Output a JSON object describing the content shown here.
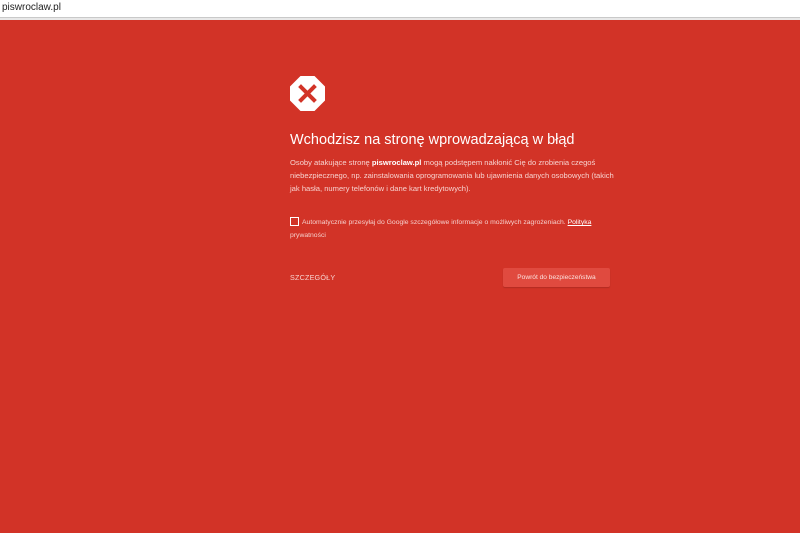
{
  "browser": {
    "url": "piswroclaw.pl"
  },
  "page": {
    "heading": "Wchodzisz na stronę wprowadzającą w błąd",
    "description": {
      "prefix": "Osoby atakujące stronę ",
      "domain": "piswroclaw.pl",
      "suffix": " mogą podstępem nakłonić Cię do zrobienia czegoś niebezpiecznego, np. zainstalowania oprogramowania lub ujawnienia danych osobowych (takich jak hasła, numery telefonów i dane kart kredytowych)."
    },
    "report_checkbox": {
      "label": "Automatycznie przesyłaj do Google szczegółowe informacje o możliwych zagrożeniach. ",
      "link": "Polityka",
      "link_continuation": "prywatności",
      "checked": false
    },
    "details_label": "SZCZEGÓŁY",
    "back_button_label": "Powrót do bezpieczeństwa"
  },
  "colors": {
    "background": "#d23327",
    "button": "#e04a3f",
    "icon_fill": "#ffffff",
    "icon_mark": "#d23327"
  },
  "icons": {
    "warning": "octagon-x-icon"
  }
}
